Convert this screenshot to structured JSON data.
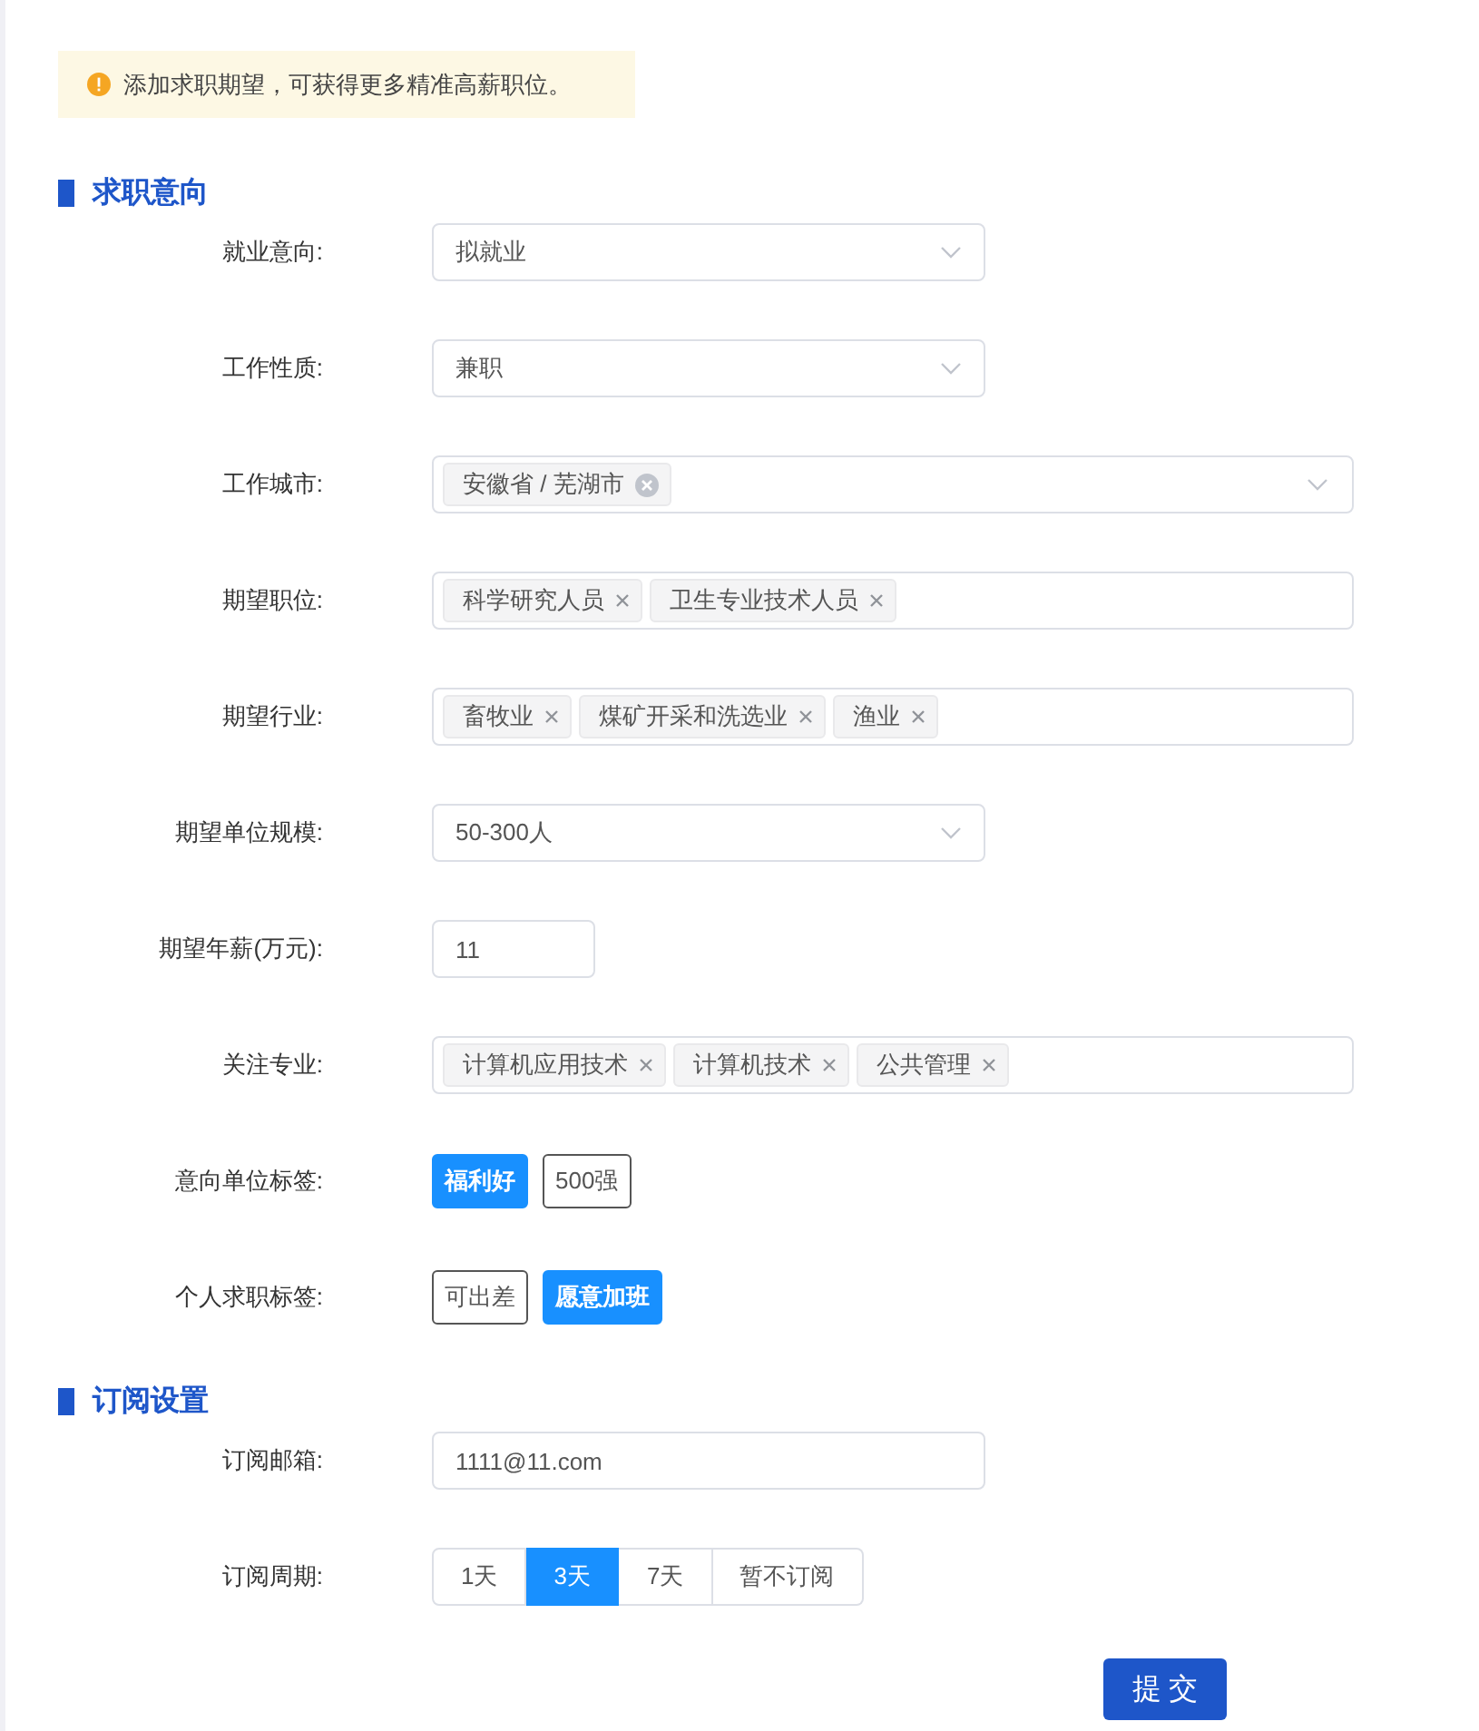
{
  "notice": {
    "text": "添加求职期望，可获得更多精准高薪职位。"
  },
  "sections": [
    {
      "title": "求职意向",
      "fields": [
        {
          "kind": "select",
          "label": "就业意向:",
          "value": "拟就业"
        },
        {
          "kind": "select",
          "label": "工作性质:",
          "value": "兼职"
        },
        {
          "kind": "cascader",
          "label": "工作城市:",
          "tags": [
            "安徽省 / 芜湖市"
          ]
        },
        {
          "kind": "multi",
          "label": "期望职位:",
          "tags": [
            "科学研究人员",
            "卫生专业技术人员"
          ]
        },
        {
          "kind": "multi",
          "label": "期望行业:",
          "tags": [
            "畜牧业",
            "煤矿开采和洗选业",
            "渔业"
          ]
        },
        {
          "kind": "select",
          "label": "期望单位规模:",
          "value": "50-300人"
        },
        {
          "kind": "input",
          "label": "期望年薪(万元):",
          "value": "11"
        },
        {
          "kind": "multi",
          "label": "关注专业:",
          "tags": [
            "计算机应用技术",
            "计算机技术",
            "公共管理"
          ]
        },
        {
          "kind": "toggles",
          "label": "意向单位标签:",
          "options": [
            {
              "label": "福利好",
              "selected": true
            },
            {
              "label": "500强",
              "selected": false
            }
          ]
        },
        {
          "kind": "toggles",
          "label": "个人求职标签:",
          "options": [
            {
              "label": "可出差",
              "selected": false
            },
            {
              "label": "愿意加班",
              "selected": true
            }
          ]
        }
      ]
    },
    {
      "title": "订阅设置",
      "fields": [
        {
          "kind": "email",
          "label": "订阅邮箱:",
          "value": "1111@11.com"
        },
        {
          "kind": "radio",
          "label": "订阅周期:",
          "options": [
            {
              "label": "1天",
              "selected": false
            },
            {
              "label": "3天",
              "selected": true
            },
            {
              "label": "7天",
              "selected": false
            },
            {
              "label": "暂不订阅",
              "selected": false
            }
          ]
        }
      ]
    }
  ],
  "submit": {
    "label": "提 交"
  }
}
